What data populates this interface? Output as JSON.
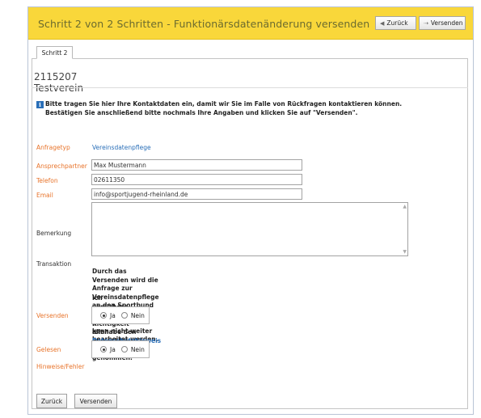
{
  "header": {
    "title": "Schritt 2 von 2 Schritten - Funktionärsdatenänderung versenden",
    "back_label": "Zurück",
    "send_label": "Versenden"
  },
  "tab": {
    "label": "Schritt 2"
  },
  "club": {
    "name": "2115207 Testverein"
  },
  "info": {
    "line1": "Bitte tragen Sie hier Ihre Kontaktdaten ein, damit wir Sie im Falle von Rückfragen kontaktieren können.",
    "line2": "Bestätigen Sie anschließend bitte nochmals Ihre Angaben und klicken Sie auf \"Versenden\"."
  },
  "form": {
    "anfragetyp_label": "Anfragetyp",
    "anfragetyp_value": "Vereinsdatenpflege",
    "ansprechpartner_label": "Ansprechpartner",
    "ansprechpartner_value": "Max Mustermann",
    "telefon_label": "Telefon",
    "telefon_value": "02611350",
    "email_label": "Email",
    "email_value": "info@sportjugend-rheinland.de",
    "bemerkung_label": "Bemerkung",
    "bemerkung_value": "",
    "transaktion_label": "Transaktion",
    "transaktion_text1": "Durch das Versenden wird die Anfrage zur Vereinsdatenpflege an den Sportbund Rheinland e.V. gesendet und",
    "transaktion_text2": "kann nicht weiter bearbeitet werden.",
    "versichere_text": "Ich versichere die Richtigkeit aller gemachten Angaben.",
    "versenden_label": "Versenden",
    "ja_label": "Ja",
    "nein_label": "Nein",
    "datenschutz_pre": "Ich habe den",
    "datenschutz_link": "Datenschutzhinweis",
    "datenschutz_post": "zur Kenntnis genommen.",
    "gelesen_label": "Gelesen",
    "hinweise_label": "Hinweise/Fehler"
  },
  "footer": {
    "back_label": "Zurück",
    "send_label": "Versenden"
  },
  "colors": {
    "header_bg": "#f9d73a",
    "label_orange": "#e8742b",
    "link_blue": "#2a6fb8"
  },
  "icons": {
    "back": "arrow-left-icon",
    "send": "send-icon",
    "info": "info-icon"
  }
}
